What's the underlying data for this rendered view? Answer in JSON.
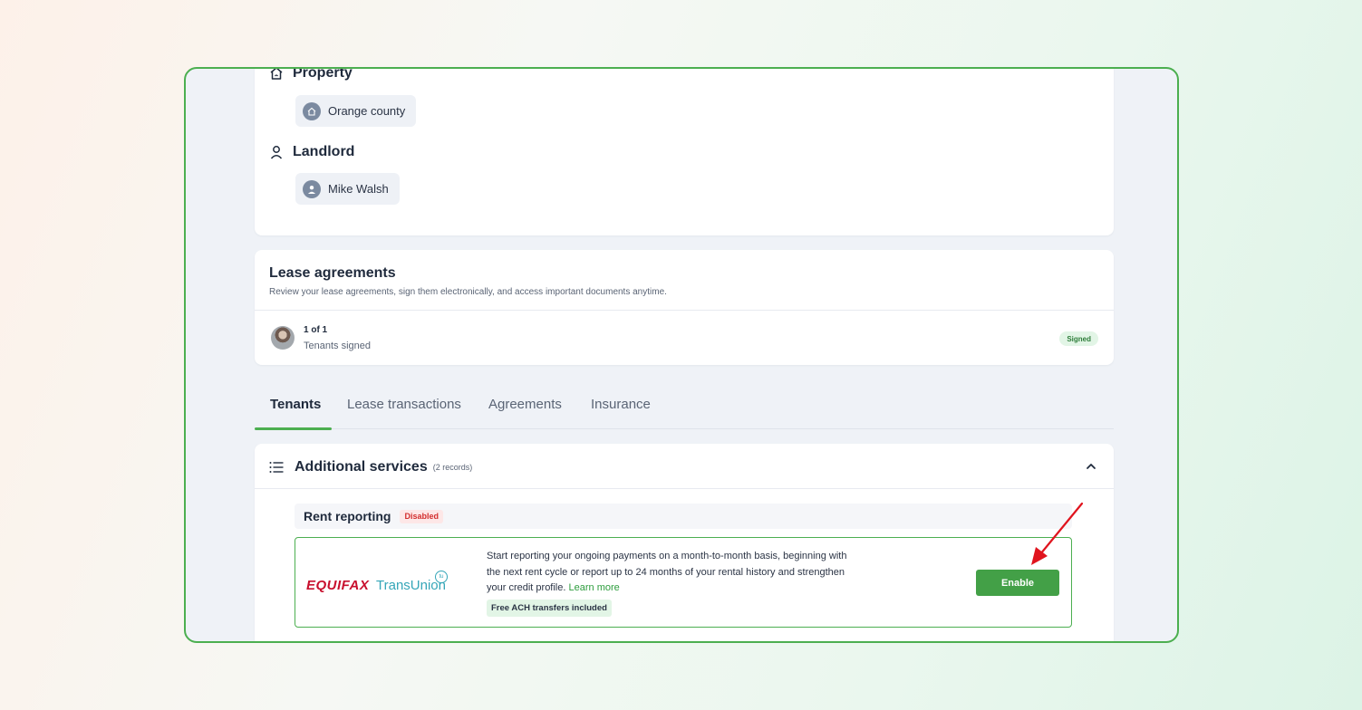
{
  "property": {
    "title": "Property",
    "chip_label": "Orange county"
  },
  "landlord": {
    "title": "Landlord",
    "chip_label": "Mike Walsh"
  },
  "lease": {
    "title": "Lease agreements",
    "subtitle": "Review your lease agreements, sign them electronically, and access important documents anytime.",
    "signed_count": "1 of 1",
    "signed_label": "Tenants signed",
    "status": "Signed"
  },
  "tabs": [
    {
      "label": "Tenants",
      "active": true
    },
    {
      "label": "Lease transactions",
      "active": false
    },
    {
      "label": "Agreements",
      "active": false
    },
    {
      "label": "Insurance",
      "active": false
    }
  ],
  "services": {
    "title": "Additional services",
    "count": "(2 records)",
    "rent_reporting": {
      "title": "Rent reporting",
      "status": "Disabled",
      "brand_equifax": "EQUIFAX",
      "brand_transunion": "TransUnion",
      "description": "Start reporting your ongoing payments on a month-to-month basis, beginning with the next rent cycle or report up to 24 months of your rental history and strengthen your credit profile.",
      "learn_more": "Learn more",
      "ach_tag": "Free ACH transfers included",
      "enable_label": "Enable"
    }
  },
  "colors": {
    "accent": "#4caf50",
    "button": "#43a047",
    "disabled": "#d32f2f",
    "annotation_arrow": "#e0141e"
  }
}
